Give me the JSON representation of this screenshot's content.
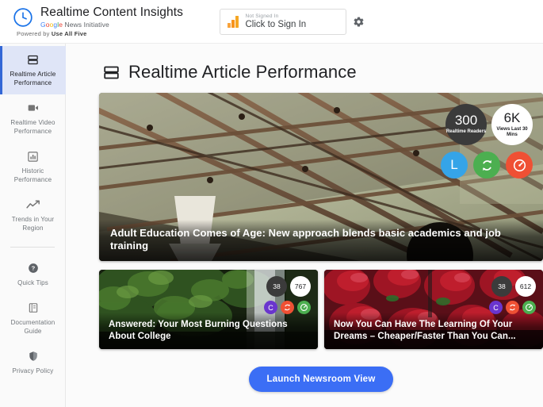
{
  "header": {
    "brand_title": "Realtime Content Insights",
    "brand_sub_google": "Google",
    "brand_sub_rest": " News Initiative",
    "powered_prefix": "Powered by ",
    "powered_name": "Use All Five",
    "logo_icon": "clock-icon",
    "signin": {
      "status": "Not Signed In",
      "action": "Click to Sign In",
      "icon": "bar-chart-icon"
    },
    "settings_icon": "gear-icon"
  },
  "sidebar": {
    "items": [
      {
        "label": "Realtime Article Performance",
        "icon": "article-rows-icon",
        "active": true
      },
      {
        "label": "Realtime Video Performance",
        "icon": "video-camera-icon",
        "active": false
      },
      {
        "label": "Historic Performance",
        "icon": "bar-chart-box-icon",
        "active": false
      },
      {
        "label": "Trends in Your Region",
        "icon": "trending-up-icon",
        "active": false
      }
    ],
    "secondary_items": [
      {
        "label": "Quick Tips",
        "icon": "help-circle-icon"
      },
      {
        "label": "Documentation Guide",
        "icon": "book-icon"
      },
      {
        "label": "Privacy Policy",
        "icon": "shield-icon"
      }
    ]
  },
  "main": {
    "page_title": "Realtime Article Performance",
    "page_title_icon": "article-rows-icon",
    "launch_button": "Launch Newsroom View",
    "hero_card": {
      "headline": "Adult Education Comes of Age: New approach blends basic academics and job training",
      "image_alt": "steel-bridge-truss-photo",
      "stats": [
        {
          "value": "300",
          "label": "Realtime Readers",
          "style": "dark"
        },
        {
          "value": "6K",
          "label": "Views Last 30 Mins",
          "style": "light"
        }
      ],
      "actions": [
        {
          "icon": "letter-l-icon",
          "glyph": "L",
          "color": "#35A4E8"
        },
        {
          "icon": "refresh-sync-icon",
          "glyph": "",
          "color": "#4CAF50"
        },
        {
          "icon": "speedometer-icon",
          "glyph": "",
          "color": "#EF5034"
        }
      ]
    },
    "cards": [
      {
        "headline": "Answered: Your Most Burning Questions About College",
        "image_alt": "waterfall-mossy-rocks-photo",
        "stats": [
          {
            "value": "38",
            "style": "dark"
          },
          {
            "value": "767",
            "style": "light"
          }
        ],
        "actions": [
          {
            "icon": "letter-c-icon",
            "glyph": "C",
            "color": "#6A35CE"
          },
          {
            "icon": "refresh-sync-icon",
            "glyph": "",
            "color": "#EF5034"
          },
          {
            "icon": "speedometer-icon",
            "glyph": "",
            "color": "#4CAF50"
          }
        ]
      },
      {
        "headline": "Now You Can Have The Learning Of Your Dreams – Cheaper/Faster Than You Can...",
        "image_alt": "strawberries-photo",
        "stats": [
          {
            "value": "38",
            "style": "dark"
          },
          {
            "value": "612",
            "style": "light"
          }
        ],
        "actions": [
          {
            "icon": "letter-c-icon",
            "glyph": "C",
            "color": "#6A35CE"
          },
          {
            "icon": "refresh-sync-icon",
            "glyph": "",
            "color": "#EF5034"
          },
          {
            "icon": "speedometer-icon",
            "glyph": "",
            "color": "#4CAF50"
          }
        ]
      }
    ]
  },
  "colors": {
    "accent_blue": "#3b6ef5",
    "active_nav_bg": "#dfe5f7",
    "active_nav_bar": "#3367D6"
  }
}
